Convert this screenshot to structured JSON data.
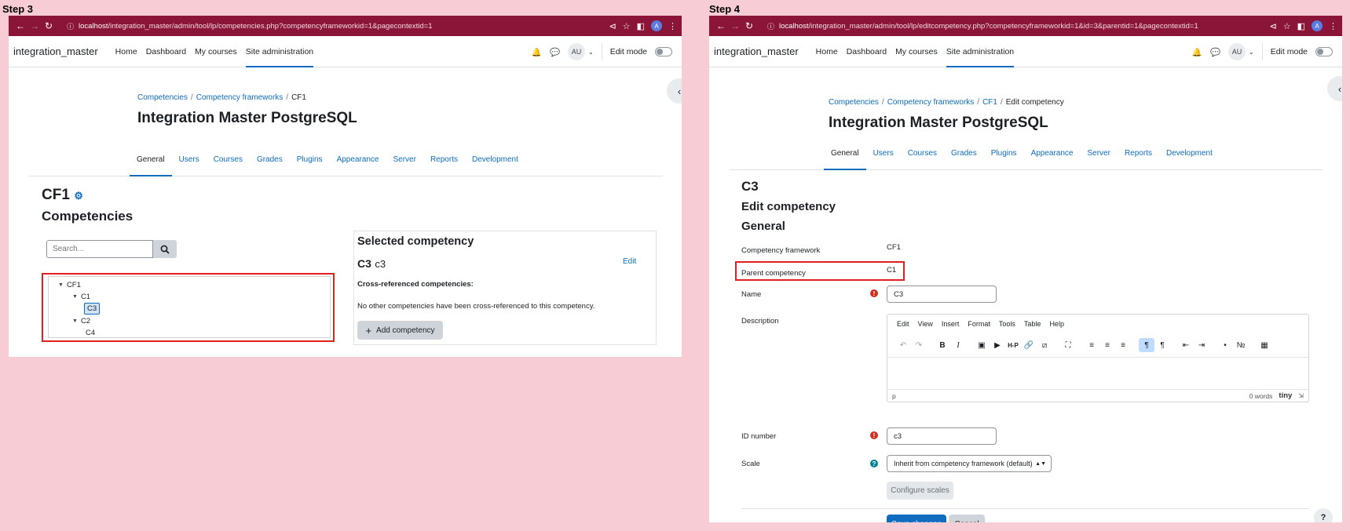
{
  "steps": [
    {
      "label": "Step 3"
    },
    {
      "label": "Step 4"
    }
  ],
  "step3": {
    "url_host": "localhost",
    "url_path": "/integration_master/admin/tool/lp/competencies.php?competencyframeworkid=1&pagecontextid=1",
    "brand": "integration_master",
    "primary_nav": [
      "Home",
      "Dashboard",
      "My courses",
      "Site administration"
    ],
    "user_initials": "AU",
    "browser_avatar": "A",
    "edit_mode": "Edit mode",
    "breadcrumb": [
      "Competencies",
      "Competency frameworks",
      "CF1"
    ],
    "page_title": "Integration Master PostgreSQL",
    "secondary_nav": [
      "General",
      "Users",
      "Courses",
      "Grades",
      "Plugins",
      "Appearance",
      "Server",
      "Reports",
      "Development"
    ],
    "framework_name": "CF1",
    "section_title": "Competencies",
    "search_placeholder": "Search...",
    "tree": {
      "root": "CF1",
      "c1": "C1",
      "c3": "C3",
      "c2": "C2",
      "c4": "C4"
    },
    "selected": {
      "heading": "Selected competency",
      "short": "C3",
      "idnumber": "c3",
      "edit": "Edit",
      "crossref_label": "Cross-referenced competencies:",
      "crossref_text": "No other competencies have been cross-referenced to this competency.",
      "add_button": "Add competency"
    }
  },
  "step4": {
    "url_host": "localhost",
    "url_path": "/integration_master/admin/tool/lp/editcompetency.php?competencyframeworkid=1&id=3&parentid=1&pagecontextid=1",
    "brand": "integration_master",
    "primary_nav": [
      "Home",
      "Dashboard",
      "My courses",
      "Site administration"
    ],
    "user_initials": "AU",
    "browser_avatar": "A",
    "edit_mode": "Edit mode",
    "breadcrumb": [
      "Competencies",
      "Competency frameworks",
      "CF1",
      "Edit competency"
    ],
    "page_title": "Integration Master PostgreSQL",
    "secondary_nav": [
      "General",
      "Users",
      "Courses",
      "Grades",
      "Plugins",
      "Appearance",
      "Server",
      "Reports",
      "Development"
    ],
    "competency_title": "C3",
    "edit_heading": "Edit competency",
    "general_heading": "General",
    "form": {
      "framework_label": "Competency framework",
      "framework_value": "CF1",
      "parent_label": "Parent competency",
      "parent_value": "C1",
      "name_label": "Name",
      "name_value": "C3",
      "description_label": "Description",
      "editor_menu": [
        "Edit",
        "View",
        "Insert",
        "Format",
        "Tools",
        "Table",
        "Help"
      ],
      "editor_path": "p",
      "editor_words": "0 words",
      "editor_brand": "tiny",
      "idnumber_label": "ID number",
      "idnumber_value": "c3",
      "scale_label": "Scale",
      "scale_value": "Inherit from competency framework (default)",
      "configure_scales": "Configure scales",
      "save": "Save changes",
      "cancel": "Cancel"
    }
  },
  "colors": {
    "browser_bar": "#8a1538",
    "background": "#f7ccd4",
    "link": "#0f6cbf",
    "highlight_box": "#e02020"
  }
}
